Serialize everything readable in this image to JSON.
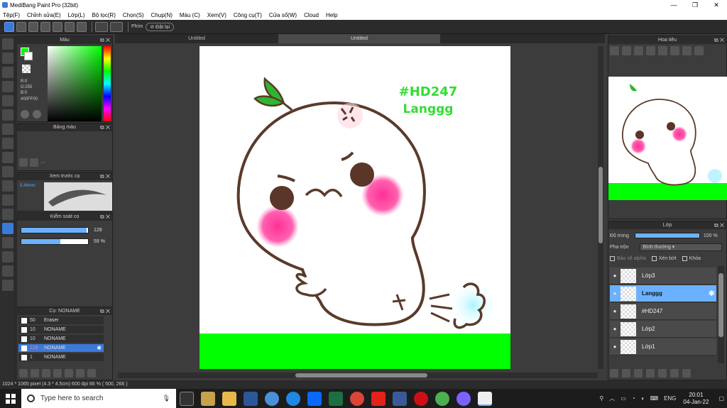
{
  "window": {
    "title": "MediBang Paint Pro (32bit)",
    "minimize": "—",
    "maximize": "❐",
    "close": "✕"
  },
  "menu": [
    "Tệp(F)",
    "Chỉnh sửa(E)",
    "Lớp(L)",
    "Bộ lọc(R)",
    "Chọn(S)",
    "Chụp(N)",
    "Màu (C)",
    "Xem(V)",
    "Công cụ(T)",
    "Cửa sổ(W)",
    "Cloud",
    "Help"
  ],
  "toolbar": {
    "key_label": "Phím",
    "reset_label": "Đặt lại"
  },
  "tabs": [
    "Untitled",
    "Untitled"
  ],
  "color_panel": {
    "title": "Màu",
    "rgb_r": "R:0",
    "rgb_g": "G:255",
    "rgb_b": "B:0",
    "hex": "#00FF00",
    "fg_color": "#00ff00",
    "bg_color": "#ffffff"
  },
  "swatch_panel": {
    "title": "Bảng màu",
    "dots": "···"
  },
  "preview_panel": {
    "title": "Xem trước cọ",
    "size": "5.46mm"
  },
  "control_panel": {
    "title": "Kiểm soát cọ",
    "size_value": "128",
    "opacity_value": "59 %",
    "size_fill": 0.98,
    "opacity_fill": 0.59
  },
  "brush_panel": {
    "title": "Cọ: NONAME",
    "brushes": [
      {
        "size": "50",
        "name": "Eraser"
      },
      {
        "size": "10",
        "name": "NONAME"
      },
      {
        "size": "10",
        "name": "NONAME"
      },
      {
        "size": "128",
        "name": "NONAME",
        "selected": true
      },
      {
        "size": "1",
        "name": "NONAME"
      }
    ]
  },
  "canvas": {
    "text_line1": "#HD247",
    "text_line2": "Langgg",
    "text_color": "#33dd33",
    "ground_color": "#00ff00",
    "line_color": "#5a3a2a",
    "blush_color": "#ff3399"
  },
  "navigator": {
    "title": "Hoa tiêu"
  },
  "layers": {
    "title": "Lớp",
    "opacity_label": "Độ trong",
    "opacity_value": "100 %",
    "blend_label": "Pha trộn",
    "blend_value": "Bình thường",
    "alpha_label": "Bảo vệ alpha",
    "clip_label": "Xén bớt",
    "lock_label": "Khóa",
    "items": [
      {
        "name": "Lớp3"
      },
      {
        "name": "Langgg",
        "selected": true
      },
      {
        "name": "#HD247"
      },
      {
        "name": "Lớp2"
      },
      {
        "name": "Lớp1"
      }
    ]
  },
  "status": {
    "text": "1024 * 1065 pixel  (4.3 * 4.5cm)  600 dpi  66 %  ( 500, 266 )"
  },
  "taskbar": {
    "search_placeholder": "Type here to search",
    "lang": "ENG",
    "time": "20:01",
    "date": "04-Jan-22"
  }
}
